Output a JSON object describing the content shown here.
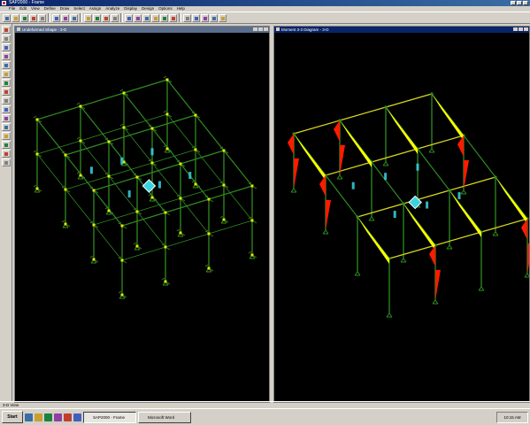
{
  "window": {
    "title": "SAP2000 - Frame"
  },
  "menu": [
    "File",
    "Edit",
    "View",
    "Define",
    "Draw",
    "Select",
    "Assign",
    "Analyze",
    "Display",
    "Design",
    "Options",
    "Help"
  ],
  "toolbar_icons": [
    "new-icon",
    "open-icon",
    "save-icon",
    "undo-icon",
    "redo-icon",
    "refresh-icon",
    "lock-icon",
    "run-icon",
    "zoom-in-icon",
    "zoom-out-icon",
    "zoom-window-icon",
    "pan-icon",
    "3d-view-icon",
    "xy-view-icon",
    "xz-view-icon",
    "yz-view-icon",
    "rotate-icon",
    "perspective-icon",
    "show-undeformed-icon",
    "show-loads-icon",
    "show-deformed-icon",
    "show-forces-icon",
    "show-stresses-icon"
  ],
  "side_icons": [
    "pointer-icon",
    "reshape-icon",
    "draw-frame-icon",
    "quick-frame-icon",
    "draw-shell-icon",
    "quick-shell-icon",
    "draw-solid-icon",
    "draw-link-icon",
    "draw-special-joint-icon",
    "select-all-icon",
    "get-previous-icon",
    "clear-selection-icon",
    "intersect-icon",
    "snap-joints-icon",
    "snap-mid-icon",
    "snap-intersect-icon"
  ],
  "viewports": {
    "left": {
      "title": "Undeformed Shape - 3-D"
    },
    "right": {
      "title": "Moment 3-3 Diagram - 3-D"
    }
  },
  "status": {
    "text": "3-D View"
  },
  "taskbar": {
    "start": "Start",
    "tasks": [
      "SAP2000 - Frame",
      "Microsoft Word"
    ],
    "clock": "10:15 AM"
  },
  "colors": {
    "frame_green": "#2e8b22",
    "joint_yellow": "#e8e800",
    "moment_yellow": "#ffff00",
    "moment_red": "#ff1a00",
    "support_cyan": "#39d4e0",
    "viewport_bg": "#000000"
  }
}
